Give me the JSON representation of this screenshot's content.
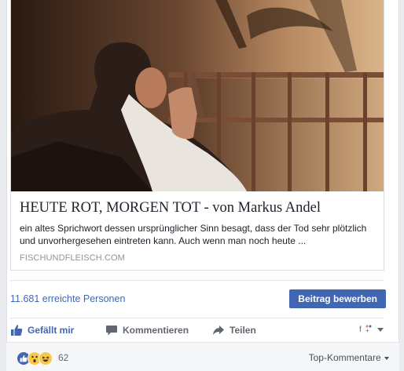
{
  "post": {
    "link_preview": {
      "title": "HEUTE ROT, MORGEN TOT - von Markus Andel",
      "description": "ein altes Sprichwort dessen ursprünglicher Sinn besagt, dass der Tod sehr plötzlich und unvorhergesehen eintreten kann. Auch wenn man noch heute ...",
      "domain": "FISCHUNDFLEISCH.COM"
    },
    "insights": {
      "reach_text": "11.681 erreichte Personen",
      "boost_label": "Beitrag bewerben"
    },
    "actions": {
      "like_label": "Gefällt mir",
      "comment_label": "Kommentieren",
      "share_label": "Teilen"
    },
    "reactions": {
      "types": [
        "like",
        "wow",
        "haha"
      ],
      "count": "62",
      "sort_label": "Top-Kommentare"
    }
  },
  "colors": {
    "facebook_blue": "#4267b2",
    "text_gray": "#606770"
  },
  "icons": [
    "thumbs-up-icon",
    "comment-icon",
    "share-icon",
    "audience-icon",
    "caret-down-icon"
  ]
}
